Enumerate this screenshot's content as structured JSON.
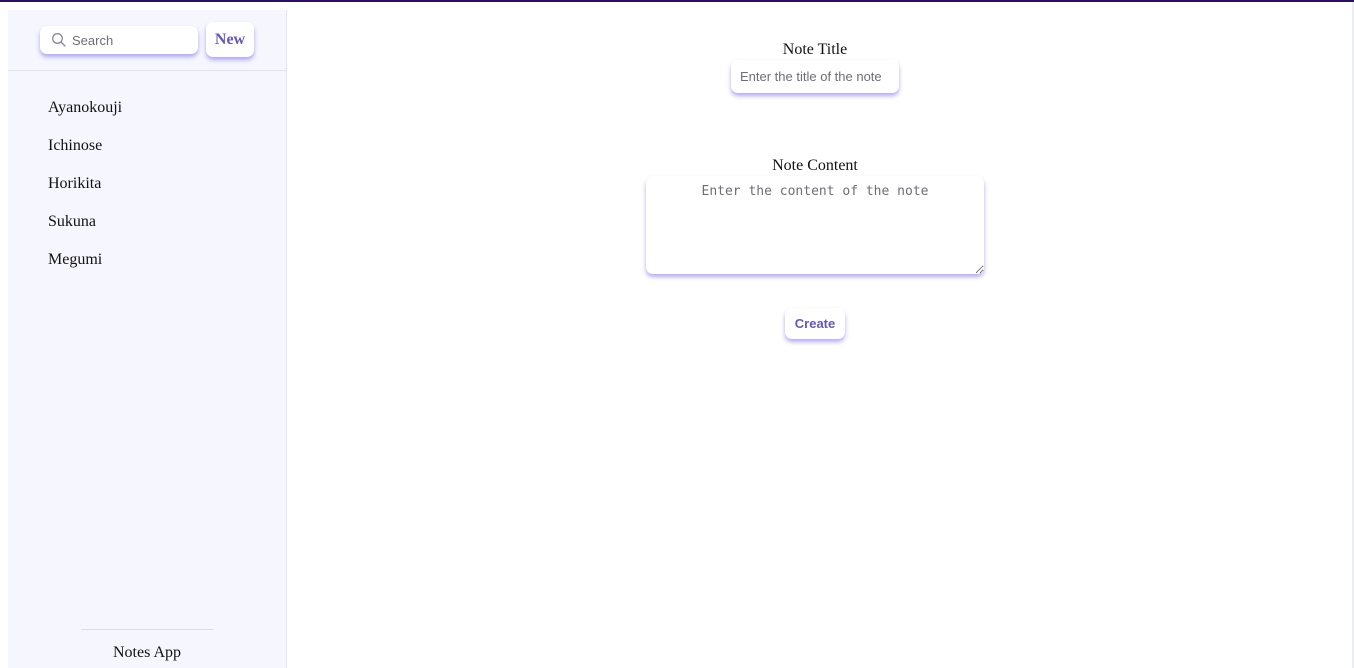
{
  "sidebar": {
    "search": {
      "placeholder": "Search",
      "value": "",
      "icon": "search-icon"
    },
    "new_button_label": "New",
    "notes": [
      {
        "label": "Ayanokouji"
      },
      {
        "label": "Ichinose"
      },
      {
        "label": "Horikita"
      },
      {
        "label": "Sukuna"
      },
      {
        "label": "Megumi"
      }
    ],
    "footer_title": "Notes App"
  },
  "main": {
    "title_label": "Note Title",
    "title_placeholder": "Enter the title of the note",
    "title_value": "",
    "content_label": "Note Content",
    "content_placeholder": "Enter the content of the note",
    "content_value": "",
    "create_label": "Create"
  },
  "colors": {
    "accent": "#6657b8",
    "shadow": "#5a46dc",
    "sidebar_bg": "#f6f6fe",
    "top_line": "#2a0f5c"
  }
}
